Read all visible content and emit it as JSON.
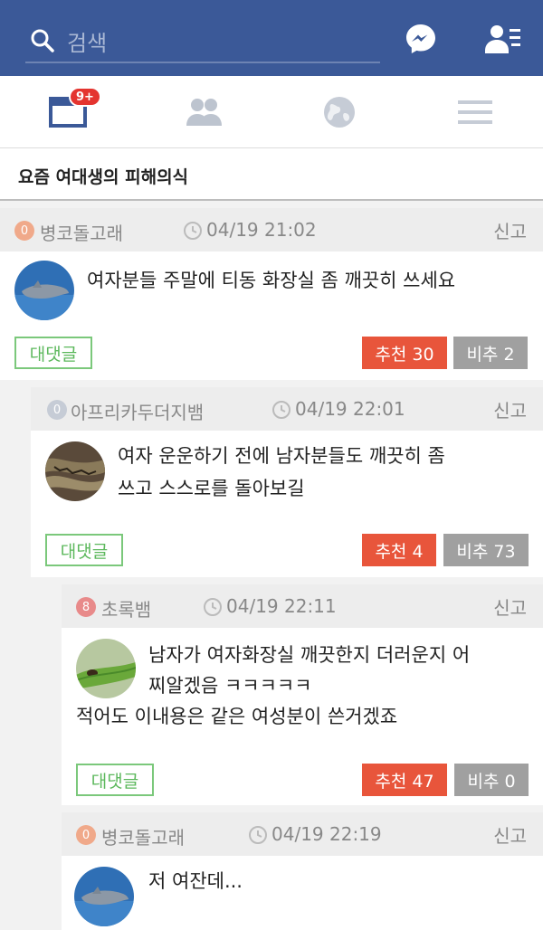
{
  "header": {
    "search_placeholder": "검색",
    "icons": {
      "search": "search-icon",
      "messenger": "messenger-icon",
      "friends": "friend-requests-icon"
    },
    "color": "#3b5998"
  },
  "tabs": {
    "news_badge": "9+",
    "items": [
      "news-feed-icon",
      "friends-icon",
      "globe-icon",
      "menu-icon"
    ]
  },
  "page": {
    "title": "요즘 여대생의 피해의식"
  },
  "comments": [
    {
      "level": "0",
      "author": "병코돌고래",
      "time": "04/19 21:02",
      "report": "신고",
      "text": "여자분들 주말에 티동 화장실 좀 깨끗히 쓰세요",
      "reply": "대댓글",
      "up": "추천 30",
      "down": "비추 2",
      "avatar": "dolphin"
    },
    {
      "level": "0",
      "author": "아프리카두더지뱀",
      "time": "04/19 22:01",
      "report": "신고",
      "text_line1": "여자 운운하기 전에 남자분들도 깨끗히 좀",
      "text_line2": "쓰고 스스로를 돌아보길",
      "reply": "대댓글",
      "up": "추천 4",
      "down": "비추 73",
      "avatar": "snake"
    },
    {
      "level": "8",
      "author": "초록뱀",
      "time": "04/19 22:11",
      "report": "신고",
      "text_line1": "남자가 여자화장실 깨끗한지 더러운지 어",
      "text_line2": "찌알겠음 ㅋㅋㅋㅋㅋ",
      "text_line3": "적어도 이내용은 같은 여성분이 쓴거겠죠",
      "reply": "대댓글",
      "up": "추천 47",
      "down": "비추 0",
      "avatar": "green-snake"
    },
    {
      "level": "0",
      "author": "병코돌고래",
      "time": "04/19 22:19",
      "report": "신고",
      "text": "저 여잔데...",
      "avatar": "dolphin"
    }
  ]
}
